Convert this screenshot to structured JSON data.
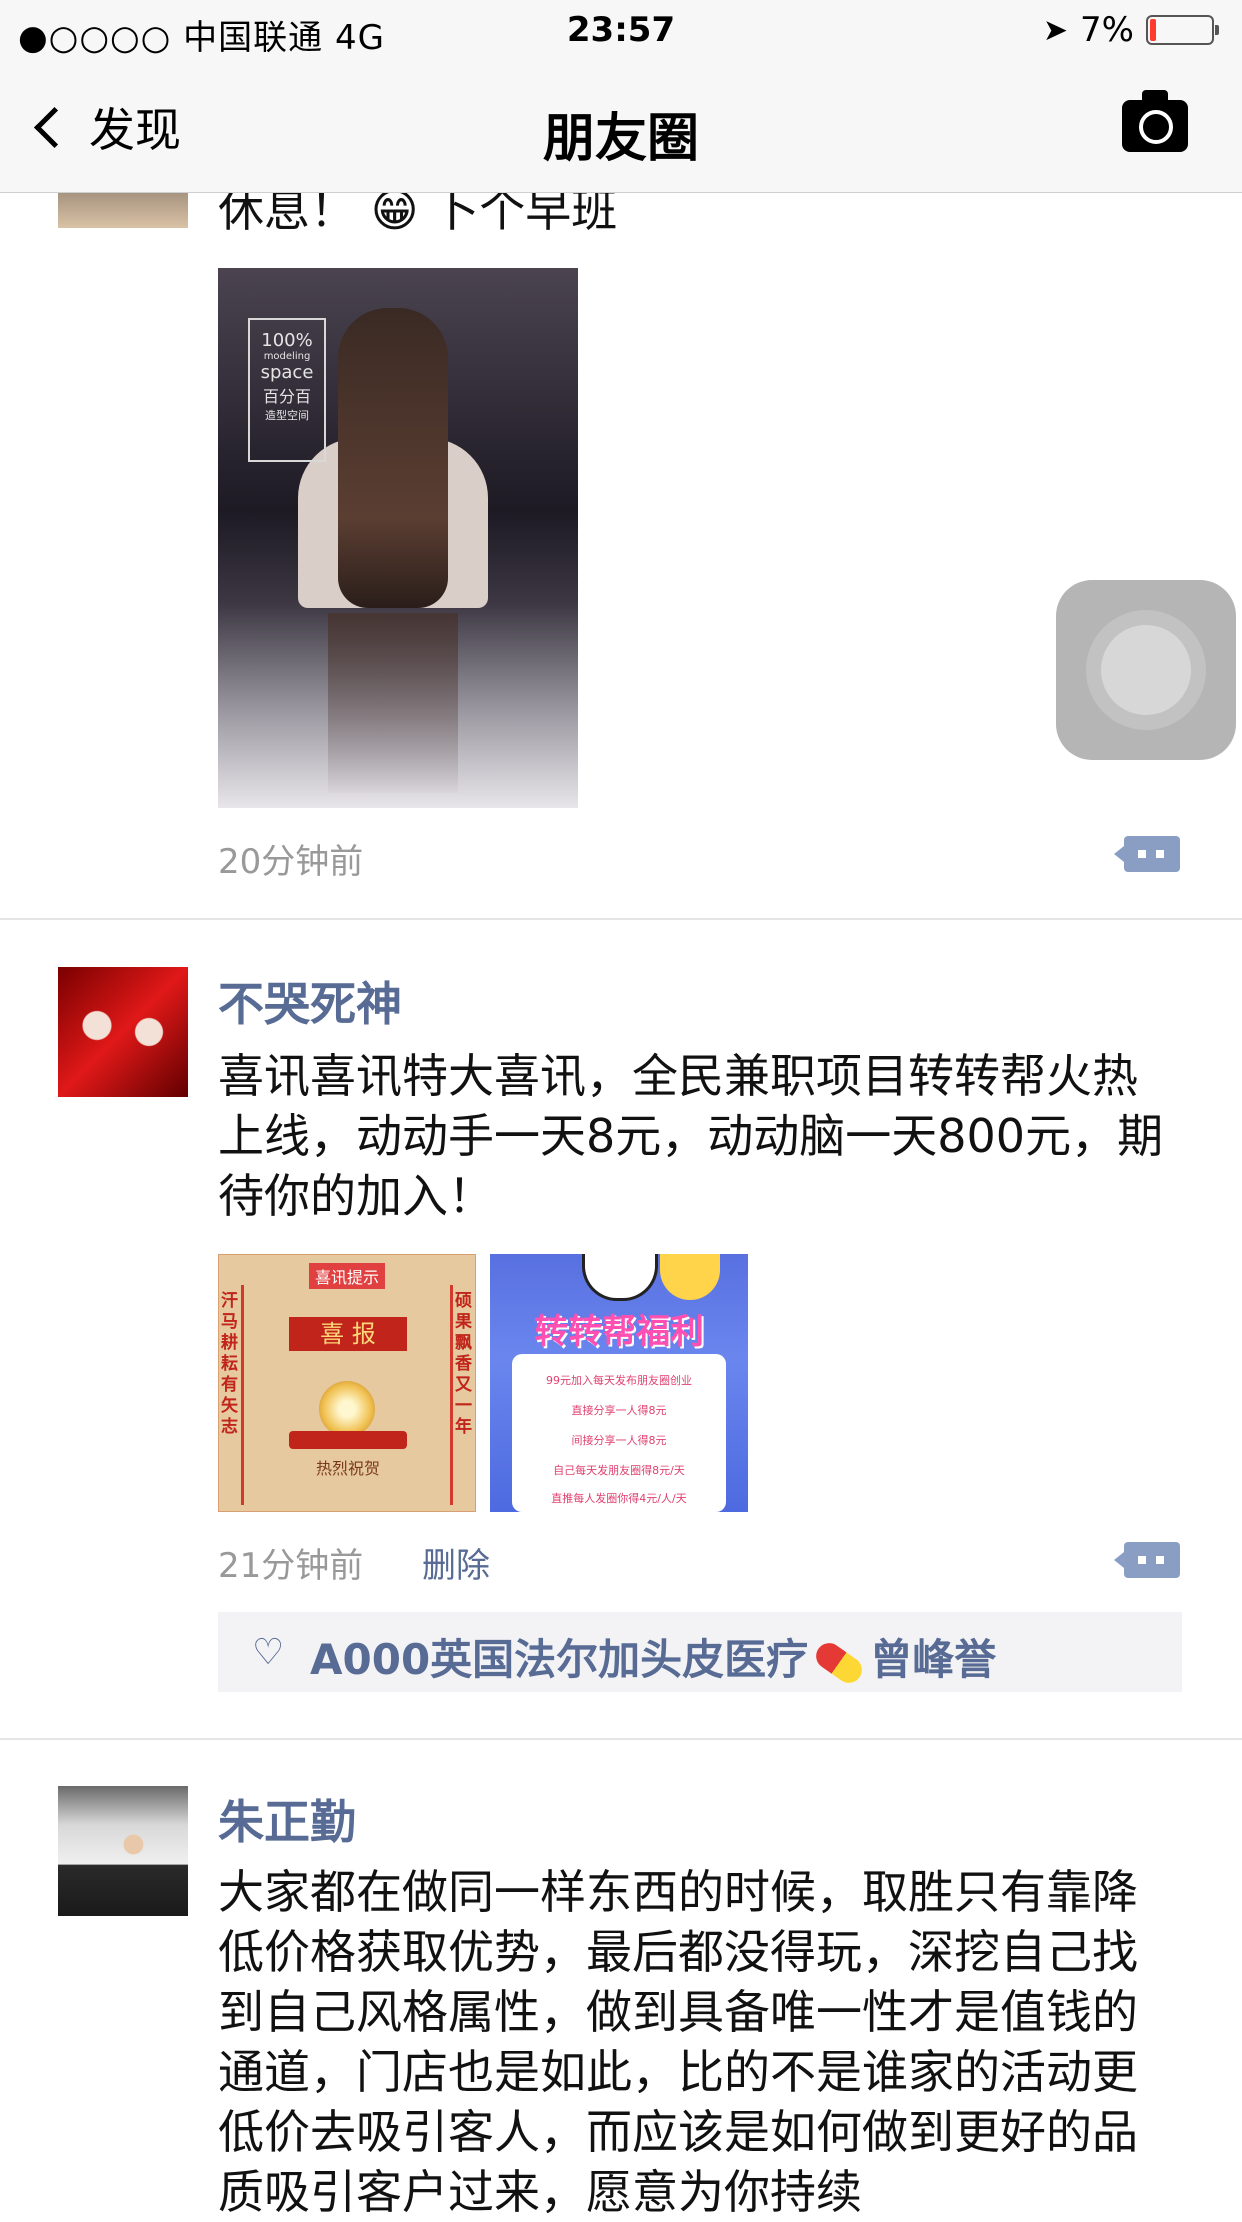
{
  "status_bar": {
    "carrier": "●○○○○ 中国联通   4G",
    "time": "23:57",
    "battery": "7%"
  },
  "nav": {
    "back_label": "发现",
    "title": "朋友圈"
  },
  "posts": [
    {
      "text": "休息！ 😁 卜个早班",
      "image_text": [
        "100%",
        "modeling",
        "space",
        "百分百",
        "造型空间"
      ],
      "time": "20分钟前"
    },
    {
      "name": "不哭死神",
      "text": "喜讯喜讯特大喜讯，全民兼职项目转转帮火热上线，动动手一天8元，动动脑一天800元，期待你的加入！",
      "image1_text": {
        "top": "喜讯提示",
        "banner": "喜 报",
        "bottom": "热烈祝贺",
        "left": "汗马耕耘有矢志",
        "right": "硕果飘香又一年"
      },
      "image2_text": {
        "title": "转转帮福利",
        "lines": [
          "99元加入每天发布朋友圈创业",
          "直接分享一人得8元",
          "间接分享一人得8元",
          "自己每天发朋友圈得8元/天",
          "直推每人发圈你得4元/人/天"
        ]
      },
      "time": "21分钟前",
      "delete_label": "删除",
      "likes": "A000英国法尔加头皮医疗",
      "likes_suffix": "曾峰誉"
    },
    {
      "name": "朱正勤",
      "text": "大家都在做同一样东西的时候，取胜只有靠降低价格获取优势，最后都没得玩，深挖自己找到自己风格属性，做到具备唯一性才是值钱的通道，门店也是如此，比的不是谁家的活动更低价去吸引客人，而应该是如何做到更好的品质吸引客户过来，愿意为你持续"
    }
  ],
  "colors": {
    "link": "#576b95",
    "time": "#999999",
    "likes_bg": "#f3f3f5"
  }
}
